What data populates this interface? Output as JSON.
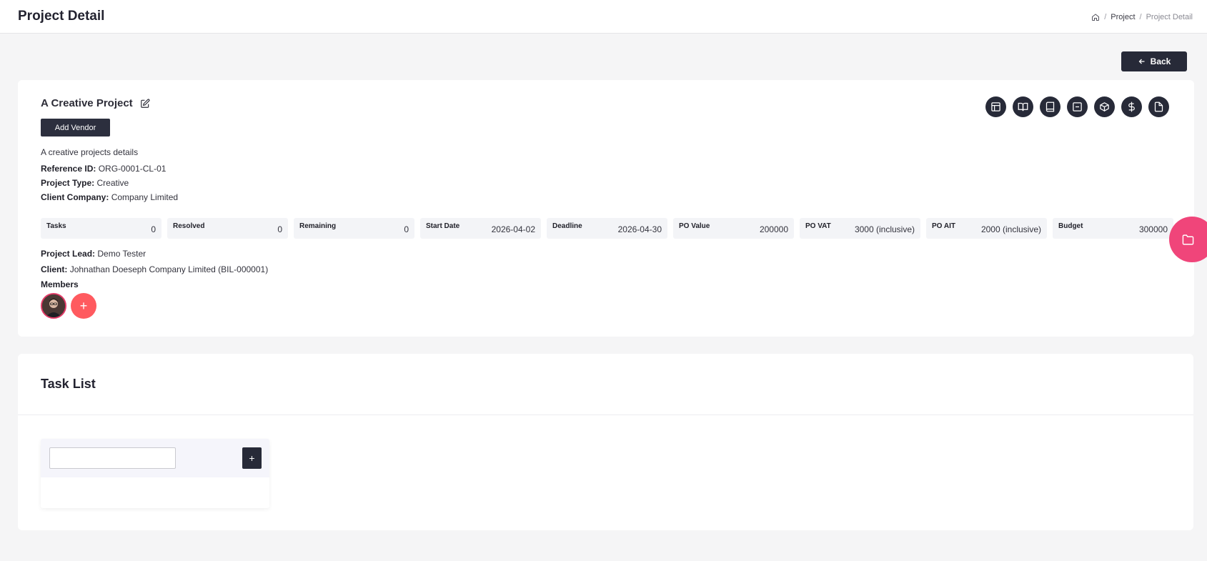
{
  "header": {
    "title": "Project Detail",
    "breadcrumb": {
      "home_icon": "home-icon",
      "separator": "/",
      "project": "Project",
      "current": "Project Detail"
    }
  },
  "back_button": {
    "label": "Back",
    "icon": "arrow-left-icon"
  },
  "project": {
    "title": "A Creative Project",
    "add_vendor_label": "Add Vendor",
    "description": "A creative projects details",
    "reference_label": "Reference ID:",
    "reference_value": "ORG-0001-CL-01",
    "type_label": "Project Type:",
    "type_value": "Creative",
    "company_label": "Client Company:",
    "company_value": "Company Limited",
    "lead_label": "Project Lead:",
    "lead_value": "Demo Tester",
    "client_label": "Client:",
    "client_value": "Johnathan Doeseph Company Limited (BIL-000001)",
    "members_label": "Members",
    "add_member_label": "+"
  },
  "action_icons": [
    "layout-icon",
    "book-open-icon",
    "book-icon",
    "minus-square-icon",
    "package-icon",
    "dollar-icon",
    "file-icon"
  ],
  "stats": [
    {
      "label": "Tasks",
      "value": "0"
    },
    {
      "label": "Resolved",
      "value": "0"
    },
    {
      "label": "Remaining",
      "value": "0"
    },
    {
      "label": "Start Date",
      "value": "2026-04-02"
    },
    {
      "label": "Deadline",
      "value": "2026-04-30"
    },
    {
      "label": "PO Value",
      "value": "200000"
    },
    {
      "label": "PO VAT",
      "value": "3000 (inclusive)"
    },
    {
      "label": "PO AIT",
      "value": "2000 (inclusive)"
    },
    {
      "label": "Budget",
      "value": "300000"
    }
  ],
  "task_list": {
    "title": "Task List",
    "input_value": "",
    "input_placeholder": "",
    "add_label": "+"
  },
  "colors": {
    "dark": "#272a38",
    "pink": "#f0457a",
    "coral": "#ff5a5f"
  }
}
